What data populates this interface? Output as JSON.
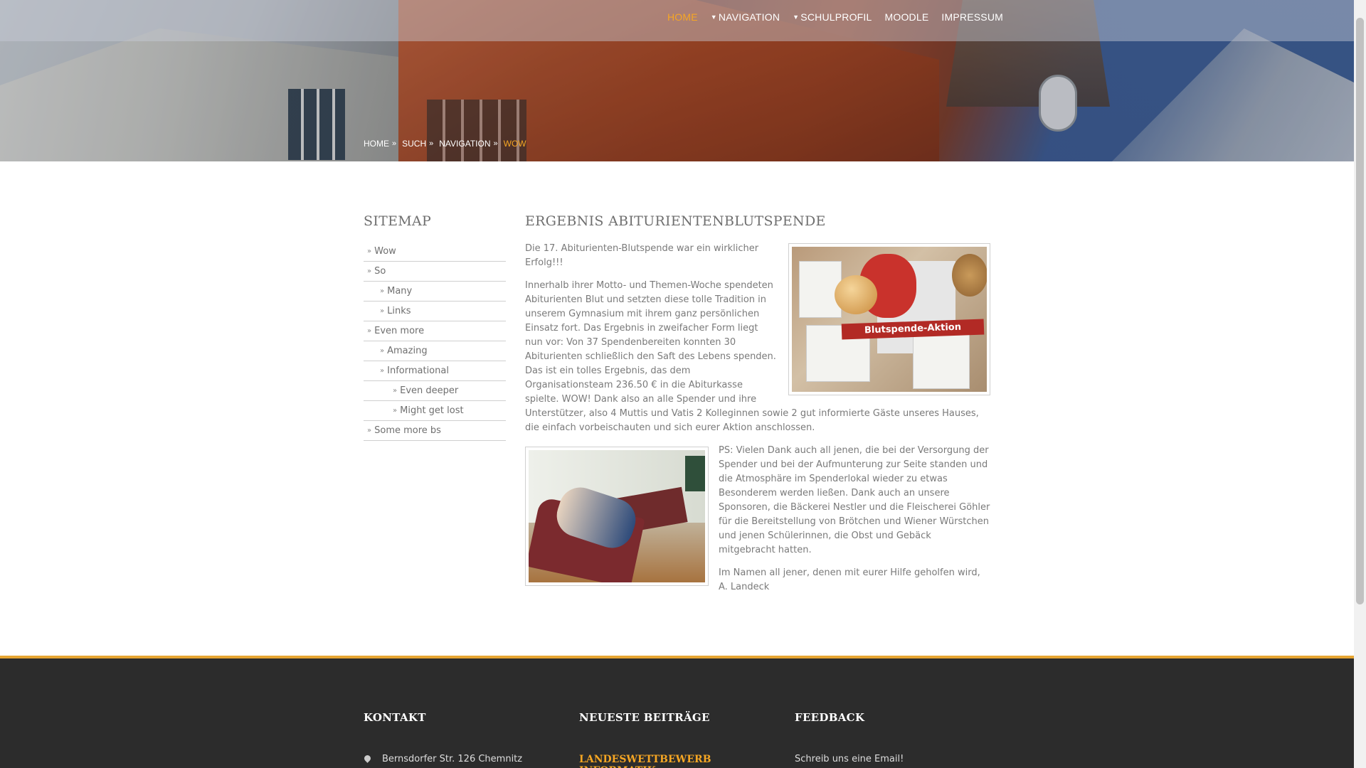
{
  "nav": {
    "items": [
      {
        "label": "HOME",
        "active": true,
        "has_caret": false
      },
      {
        "label": "NAVIGATION",
        "active": false,
        "has_caret": true
      },
      {
        "label": "SCHULPROFIL",
        "active": false,
        "has_caret": true
      },
      {
        "label": "MOODLE",
        "active": false,
        "has_caret": false
      },
      {
        "label": "IMPRESSUM",
        "active": false,
        "has_caret": false
      }
    ]
  },
  "breadcrumb": {
    "items": [
      "HOME",
      "SUCH",
      "NAVIGATION"
    ],
    "current": "WOW",
    "separator": "»"
  },
  "sidebar": {
    "title": "SITEMAP",
    "items": [
      {
        "label": "Wow",
        "level": 1
      },
      {
        "label": "So",
        "level": 1
      },
      {
        "label": "Many",
        "level": 2
      },
      {
        "label": "Links",
        "level": 2
      },
      {
        "label": "Even more",
        "level": 1
      },
      {
        "label": "Amazing",
        "level": 2
      },
      {
        "label": "Informational",
        "level": 2
      },
      {
        "label": "Even deeper",
        "level": 3
      },
      {
        "label": "Might get lost",
        "level": 3
      },
      {
        "label": "Some more bs",
        "level": 1
      }
    ]
  },
  "article": {
    "title": "ERGEBNIS ABITURIENTENBLUTSPENDE",
    "p1": "Die 17. Abiturienten-Blutspende war ein wirklicher Erfolg!!!",
    "p2": "Innerhalb ihrer Motto- und Themen-Woche spendeten Abiturienten Blut und setzten diese tolle Tradition in unserem Gymnasium mit ihrem ganz persönlichen Einsatz fort. Das Ergebnis in zweifacher Form liegt nun vor: Von 37 Spendenbereiten konnten 30 Abiturienten schließlich den Saft des Lebens spenden. Das ist ein tolles Ergebnis, das dem Organisationsteam 236.50 € in die Abiturkasse spielte. WOW! Dank also an alle Spender und ihre Unterstützer, also 4 Muttis und Vatis 2 Kolleginnen sowie 2 gut informierte Gäste unseres Hauses, die einfach vorbeischauten und sich eurer Aktion anschlossen.",
    "p3": "PS: Vielen Dank auch all jenen, die bei der Versorgung der Spender und bei der Aufmunterung zur Seite standen und die Atmosphäre im Spenderlokal wieder zu etwas Besonderem werden ließen. Dank auch an unsere Sponsoren, die Bäckerei Nestler und die Fleischerei Göhler für die Bereitstellung von Brötchen und Wiener Würstchen und jenen Schülerinnen, die Obst und Gebäck mitgebracht hatten.",
    "p4": "Im Namen all jener, denen mit eurer Hilfe geholfen wird, A. Landeck",
    "photo1_banner": "Blutspende-Aktion"
  },
  "footer": {
    "contact": {
      "title": "KONTAKT",
      "address": "Bernsdorfer Str. 126 Chemnitz"
    },
    "posts": {
      "title": "NEUESTE BEITRÄGE",
      "latest": "LANDESWETTBEWERB INFORMATIK"
    },
    "feedback": {
      "title": "FEEDBACK",
      "text": "Schreib uns eine Email!"
    }
  },
  "colors": {
    "accent": "#f6a623",
    "footer_bg": "#2c2c2c",
    "footer_line": "#e6a532"
  }
}
